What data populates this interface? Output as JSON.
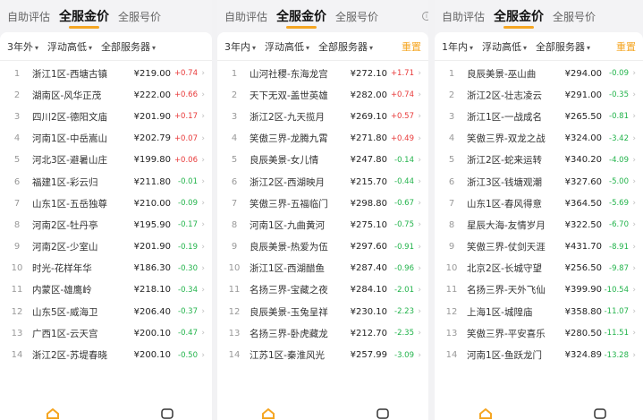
{
  "tabs": [
    "自助评估",
    "全服金价",
    "全服号价"
  ],
  "reset_label": "重置",
  "colors": {
    "accent": "#f5a623",
    "up": "#e83a3a",
    "down": "#22b34b"
  },
  "panels": [
    {
      "filters": [
        "3年外",
        "浮动高低",
        "全部服务器"
      ],
      "rows": [
        {
          "rank": "1",
          "name": "浙江1区-西塘古镇",
          "price": "¥219.00",
          "change": "+0.74",
          "dir": "up"
        },
        {
          "rank": "2",
          "name": "湖南区-风华正茂",
          "price": "¥222.00",
          "change": "+0.66",
          "dir": "up"
        },
        {
          "rank": "3",
          "name": "四川2区-德阳文庙",
          "price": "¥201.90",
          "change": "+0.17",
          "dir": "up"
        },
        {
          "rank": "4",
          "name": "河南1区-中岳嵩山",
          "price": "¥202.79",
          "change": "+0.07",
          "dir": "up"
        },
        {
          "rank": "5",
          "name": "河北3区-避暑山庄",
          "price": "¥199.80",
          "change": "+0.06",
          "dir": "up"
        },
        {
          "rank": "6",
          "name": "福建1区-彩云归",
          "price": "¥211.80",
          "change": "-0.01",
          "dir": "down"
        },
        {
          "rank": "7",
          "name": "山东1区-五岳独尊",
          "price": "¥210.00",
          "change": "-0.09",
          "dir": "down"
        },
        {
          "rank": "8",
          "name": "河南2区-牡丹亭",
          "price": "¥195.90",
          "change": "-0.17",
          "dir": "down"
        },
        {
          "rank": "9",
          "name": "河南2区-少室山",
          "price": "¥201.90",
          "change": "-0.19",
          "dir": "down"
        },
        {
          "rank": "10",
          "name": "时光-花样年华",
          "price": "¥186.30",
          "change": "-0.30",
          "dir": "down"
        },
        {
          "rank": "11",
          "name": "内蒙区-雄鹰岭",
          "price": "¥218.10",
          "change": "-0.34",
          "dir": "down"
        },
        {
          "rank": "12",
          "name": "山东5区-威海卫",
          "price": "¥206.40",
          "change": "-0.37",
          "dir": "down"
        },
        {
          "rank": "13",
          "name": "广西1区-云天宫",
          "price": "¥200.10",
          "change": "-0.47",
          "dir": "down"
        },
        {
          "rank": "14",
          "name": "浙江2区-苏堤春晓",
          "price": "¥200.10",
          "change": "-0.50",
          "dir": "down"
        }
      ]
    },
    {
      "filters": [
        "3年内",
        "浮动高低",
        "全部服务器"
      ],
      "rows": [
        {
          "rank": "1",
          "name": "山河社稷-东海龙宫",
          "price": "¥272.10",
          "change": "+1.71",
          "dir": "up"
        },
        {
          "rank": "2",
          "name": "天下无双-盖世英雄",
          "price": "¥282.00",
          "change": "+0.74",
          "dir": "up"
        },
        {
          "rank": "3",
          "name": "浙江2区-九天揽月",
          "price": "¥269.10",
          "change": "+0.57",
          "dir": "up"
        },
        {
          "rank": "4",
          "name": "笑傲三界-龙腾九霄",
          "price": "¥271.80",
          "change": "+0.49",
          "dir": "up"
        },
        {
          "rank": "5",
          "name": "良辰美景-女儿情",
          "price": "¥247.80",
          "change": "-0.14",
          "dir": "down"
        },
        {
          "rank": "6",
          "name": "浙江2区-西湖映月",
          "price": "¥215.70",
          "change": "-0.44",
          "dir": "down"
        },
        {
          "rank": "7",
          "name": "笑傲三界-五福临门",
          "price": "¥298.80",
          "change": "-0.67",
          "dir": "down"
        },
        {
          "rank": "8",
          "name": "河南1区-九曲黄河",
          "price": "¥275.10",
          "change": "-0.75",
          "dir": "down"
        },
        {
          "rank": "9",
          "name": "良辰美景-热爱为伍",
          "price": "¥297.60",
          "change": "-0.91",
          "dir": "down"
        },
        {
          "rank": "10",
          "name": "浙江1区-西湖醋鱼",
          "price": "¥287.40",
          "change": "-0.96",
          "dir": "down"
        },
        {
          "rank": "11",
          "name": "名扬三界-宝藏之夜",
          "price": "¥284.10",
          "change": "-2.01",
          "dir": "down"
        },
        {
          "rank": "12",
          "name": "良辰美景-玉兔呈祥",
          "price": "¥230.10",
          "change": "-2.23",
          "dir": "down"
        },
        {
          "rank": "13",
          "name": "名扬三界-卧虎藏龙",
          "price": "¥212.70",
          "change": "-2.35",
          "dir": "down"
        },
        {
          "rank": "14",
          "name": "江苏1区-秦淮风光",
          "price": "¥257.99",
          "change": "-3.09",
          "dir": "down"
        }
      ]
    },
    {
      "filters": [
        "1年内",
        "浮动高低",
        "全部服务器"
      ],
      "rows": [
        {
          "rank": "1",
          "name": "良辰美景-巫山曲",
          "price": "¥294.00",
          "change": "-0.09",
          "dir": "down"
        },
        {
          "rank": "2",
          "name": "浙江2区-壮志凌云",
          "price": "¥291.00",
          "change": "-0.35",
          "dir": "down"
        },
        {
          "rank": "3",
          "name": "浙江1区-一战成名",
          "price": "¥265.50",
          "change": "-0.81",
          "dir": "down"
        },
        {
          "rank": "4",
          "name": "笑傲三界-双龙之战",
          "price": "¥324.00",
          "change": "-3.42",
          "dir": "down"
        },
        {
          "rank": "5",
          "name": "浙江2区-蛇来运转",
          "price": "¥340.20",
          "change": "-4.09",
          "dir": "down"
        },
        {
          "rank": "6",
          "name": "浙江3区-钱塘观潮",
          "price": "¥327.60",
          "change": "-5.00",
          "dir": "down"
        },
        {
          "rank": "7",
          "name": "山东1区-春风得意",
          "price": "¥364.50",
          "change": "-5.69",
          "dir": "down"
        },
        {
          "rank": "8",
          "name": "星辰大海-友情岁月",
          "price": "¥322.50",
          "change": "-6.70",
          "dir": "down"
        },
        {
          "rank": "9",
          "name": "笑傲三界-仗剑天涯",
          "price": "¥431.70",
          "change": "-8.91",
          "dir": "down"
        },
        {
          "rank": "10",
          "name": "北京2区-长城守望",
          "price": "¥256.50",
          "change": "-9.87",
          "dir": "down"
        },
        {
          "rank": "11",
          "name": "名扬三界-天外飞仙",
          "price": "¥399.90",
          "change": "-10.54",
          "dir": "down"
        },
        {
          "rank": "12",
          "name": "上海1区-城隍庙",
          "price": "¥358.80",
          "change": "-11.07",
          "dir": "down"
        },
        {
          "rank": "13",
          "name": "笑傲三界-平安喜乐",
          "price": "¥280.50",
          "change": "-11.51",
          "dir": "down"
        },
        {
          "rank": "14",
          "name": "河南1区-鱼跃龙门",
          "price": "¥324.89",
          "change": "-13.28",
          "dir": "down"
        }
      ]
    }
  ]
}
